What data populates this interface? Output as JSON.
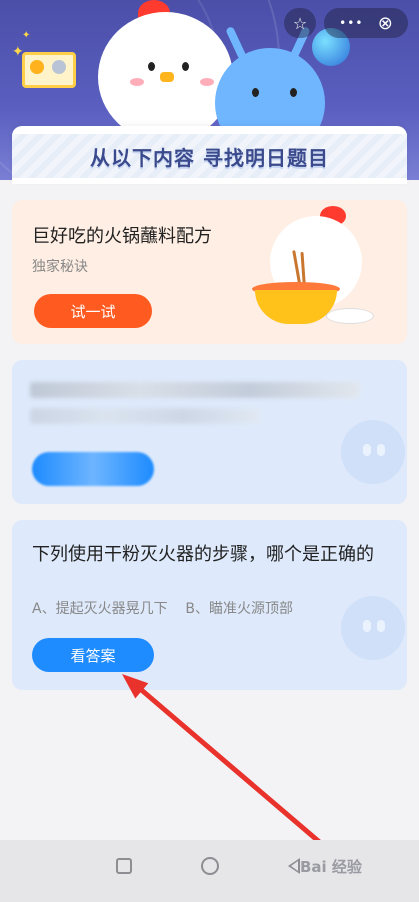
{
  "header": {
    "banner_title": "从以下内容 寻找明日题目",
    "star_icon": "☆",
    "more_icon": "•••",
    "close_icon": "⊗"
  },
  "cards": [
    {
      "title": "巨好吃的火锅蘸料配方",
      "subtitle": "独家秘诀",
      "button": "试一试"
    },
    {
      "title": "",
      "button": ""
    },
    {
      "title": "下列使用干粉灭火器的步骤，哪个是正确的",
      "options": "A、提起灭火器晃几下    B、瞄准火源顶部",
      "button": "看答案"
    }
  ],
  "watermark": "Bai 经验",
  "colors": {
    "header": "#5a5fc0",
    "orange_button": "#ff5a20",
    "blue_button": "#1e8bff",
    "arrow": "#e8322b"
  }
}
